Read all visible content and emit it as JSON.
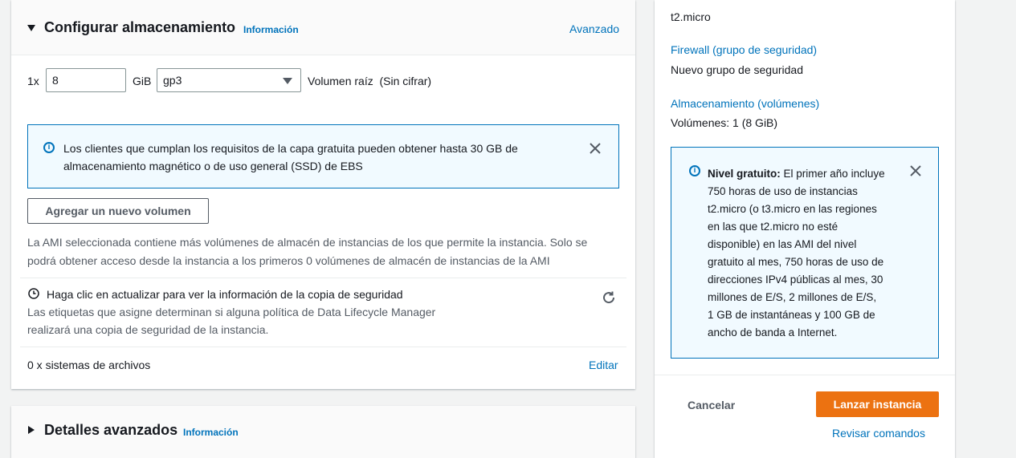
{
  "storage": {
    "title": "Configurar almacenamiento",
    "info_link": "Información",
    "advanced_link": "Avanzado",
    "volume": {
      "count_label": "1x",
      "size_value": "8",
      "unit_label": "GiB",
      "type_value": "gp3",
      "root_label": "Volumen raíz  (Sin cifrar)"
    },
    "free_tier_alert": {
      "line1": "Los clientes que cumplan los requisitos de la capa gratuita pueden obtener hasta 30 GB de",
      "line2": "almacenamiento magnético o de uso general (SSD) de EBS"
    },
    "add_volume_button": "Agregar un nuevo volumen",
    "ami_notice": {
      "line1": "La AMI seleccionada contiene más volúmenes de almacén de instancias de los que permite la instancia. Solo se",
      "line2": "podrá obtener acceso desde la instancia a los primeros 0 volúmenes de almacén de instancias de la AMI"
    },
    "backup": {
      "title": "Haga clic en actualizar para ver la información de la copia de seguridad",
      "line1": "Las etiquetas que asigne determinan si alguna política de Data Lifecycle Manager",
      "line2": "realizará una copia de seguridad de la instancia."
    },
    "file_systems": {
      "label": "0 x sistemas de archivos",
      "edit_link": "Editar"
    }
  },
  "advanced": {
    "title": "Detalles avanzados",
    "info_link": "Información"
  },
  "summary": {
    "instance_type_value": "t2.micro",
    "firewall_link": "Firewall (grupo de seguridad)",
    "firewall_value": "Nuevo grupo de seguridad",
    "storage_link": "Almacenamiento (volúmenes)",
    "storage_value": "Volúmenes: 1 (8 GiB)",
    "free_tier_box": {
      "bold": "Nivel gratuito:",
      "first_line_rest": "El primer año incluye",
      "lines": [
        "750 horas de uso de instancias",
        "t2.micro (o t3.micro en las regiones",
        "en las que t2.micro no esté",
        "disponible) en las AMI del nivel",
        "gratuito al mes, 750 horas de uso de",
        "direcciones IPv4 públicas al mes, 30",
        "millones de E/S, 2 millones de E/S,",
        "1 GB de instantáneas y 100 GB de",
        "ancho de banda a Internet."
      ]
    },
    "cancel_button": "Cancelar",
    "launch_button": "Lanzar instancia",
    "review_link": "Revisar comandos"
  },
  "colors": {
    "link": "#0073bb",
    "primary": "#ec7211",
    "alert_bg": "#f1faff"
  }
}
